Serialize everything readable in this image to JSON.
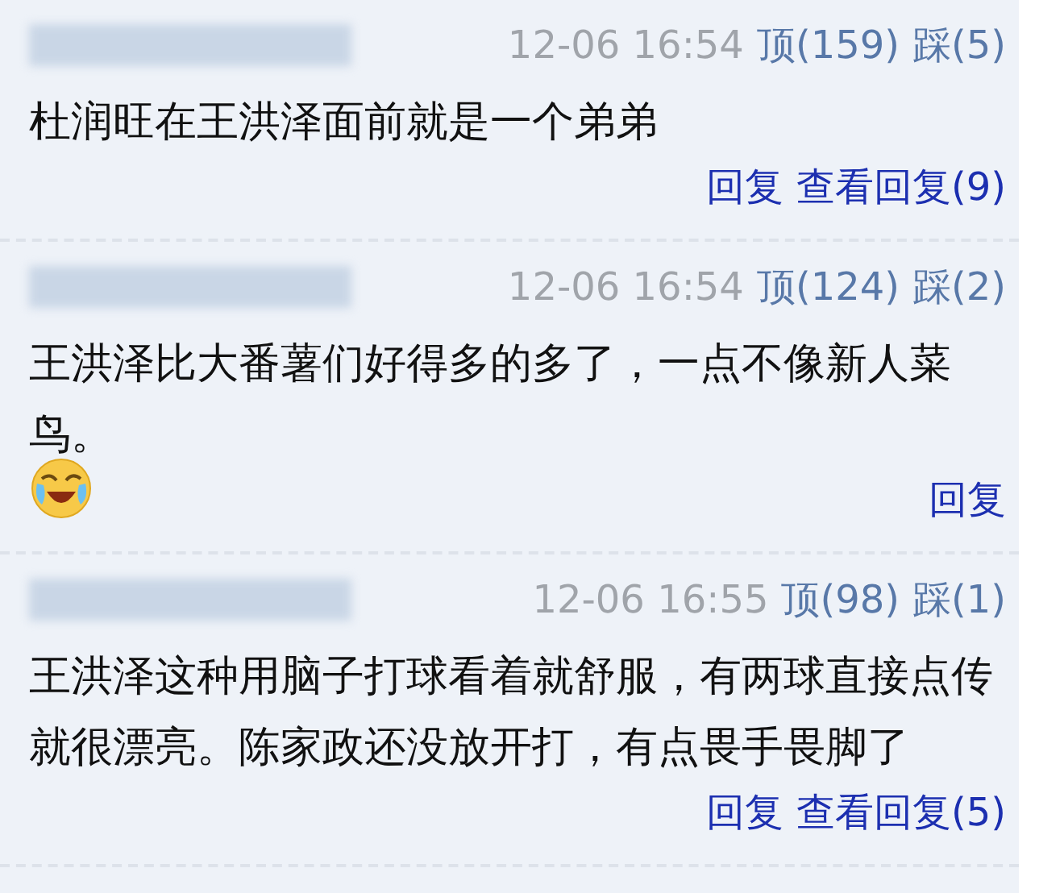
{
  "comments": [
    {
      "time": "12-06 16:54",
      "up": "顶(159)",
      "down": "踩(5)",
      "text": "杜润旺在王洪泽面前就是一个弟弟",
      "emoji": false,
      "actions": [
        "回复",
        "查看回复(9)"
      ]
    },
    {
      "time": "12-06 16:54",
      "up": "顶(124)",
      "down": "踩(2)",
      "text": "王洪泽比大番薯们好得多的多了，一点不像新人菜鸟。",
      "emoji": true,
      "actions": [
        "回复"
      ]
    },
    {
      "time": "12-06 16:55",
      "up": "顶(98)",
      "down": "踩(1)",
      "text": "王洪泽这种用脑子打球看着就舒服，有两球直接点传就很漂亮。陈家政还没放开打，有点畏手畏脚了",
      "emoji": false,
      "actions": [
        "回复",
        "查看回复(5)"
      ]
    }
  ]
}
